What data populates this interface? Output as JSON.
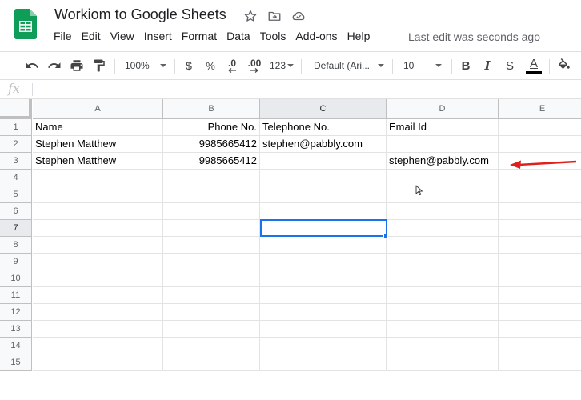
{
  "document": {
    "title": "Workiom to Google Sheets",
    "last_edit": "Last edit was seconds ago"
  },
  "menu": [
    "File",
    "Edit",
    "View",
    "Insert",
    "Format",
    "Data",
    "Tools",
    "Add-ons",
    "Help"
  ],
  "toolbar": {
    "zoom": "100%",
    "currency": "$",
    "percent": "%",
    "decrease_decimal": ".0",
    "increase_decimal": ".00",
    "more_formats": "123",
    "font_family": "Default (Ari...",
    "font_size": "10",
    "bold": "B",
    "italic": "I",
    "strikethrough": "S",
    "text_color_letter": "A",
    "text_color": "#000000"
  },
  "formula_bar": {
    "label": "fx",
    "value": ""
  },
  "grid": {
    "columns": [
      "A",
      "B",
      "C",
      "D",
      "E"
    ],
    "row_numbers": [
      "1",
      "2",
      "3",
      "4",
      "5",
      "6",
      "7",
      "8",
      "9",
      "10",
      "11",
      "12",
      "13",
      "14",
      "15"
    ],
    "rows": [
      [
        "Name",
        "Phone No.",
        "Telephone No.",
        "Email Id",
        ""
      ],
      [
        "Stephen Matthew",
        "9985665412",
        "stephen@pabbly.com",
        "",
        ""
      ],
      [
        "Stephen Matthew",
        "9985665412",
        "",
        "stephen@pabbly.com",
        ""
      ]
    ],
    "selected_cell": "C7",
    "selection_color": "#1a73e8"
  },
  "annotation": {
    "arrow_color": "#e0201b",
    "points_to": "D3"
  },
  "colors": {
    "brand_green": "#0f9d58",
    "header_bg": "#f8f9fa",
    "grid_line": "#e2e3e3"
  }
}
